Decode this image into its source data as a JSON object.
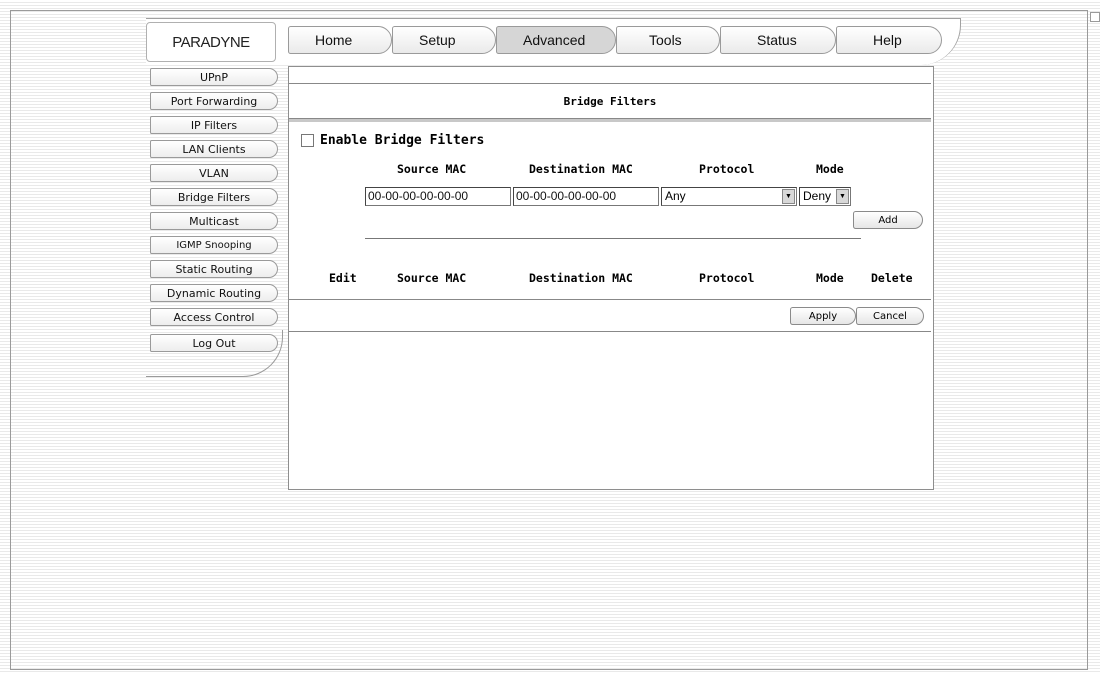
{
  "logo": {
    "text": "PARADYNE"
  },
  "nav": {
    "tabs": [
      {
        "label": "Home"
      },
      {
        "label": "Setup"
      },
      {
        "label": "Advanced"
      },
      {
        "label": "Tools"
      },
      {
        "label": "Status"
      },
      {
        "label": "Help"
      }
    ],
    "active": "Advanced"
  },
  "sidebar": {
    "items": [
      {
        "label": "UPnP"
      },
      {
        "label": "Port Forwarding"
      },
      {
        "label": "IP Filters"
      },
      {
        "label": "LAN Clients"
      },
      {
        "label": "VLAN"
      },
      {
        "label": "Bridge Filters"
      },
      {
        "label": "Multicast"
      },
      {
        "label": "IGMP Snooping"
      },
      {
        "label": "Static Routing"
      },
      {
        "label": "Dynamic Routing"
      },
      {
        "label": "Access Control"
      }
    ],
    "logout_label": "Log Out"
  },
  "page": {
    "title": "Bridge Filters",
    "enable_label": "Enable Bridge Filters",
    "enable_checked": false
  },
  "form": {
    "headers": {
      "source_mac": "Source MAC",
      "destination_mac": "Destination MAC",
      "protocol": "Protocol",
      "mode": "Mode"
    },
    "source_mac_value": "00-00-00-00-00-00",
    "destination_mac_value": "00-00-00-00-00-00",
    "protocol_value": "Any",
    "mode_value": "Deny",
    "add_label": "Add"
  },
  "table": {
    "headers": {
      "edit": "Edit",
      "source_mac": "Source MAC",
      "destination_mac": "Destination MAC",
      "protocol": "Protocol",
      "mode": "Mode",
      "delete": "Delete"
    },
    "rows": []
  },
  "actions": {
    "apply_label": "Apply",
    "cancel_label": "Cancel"
  }
}
